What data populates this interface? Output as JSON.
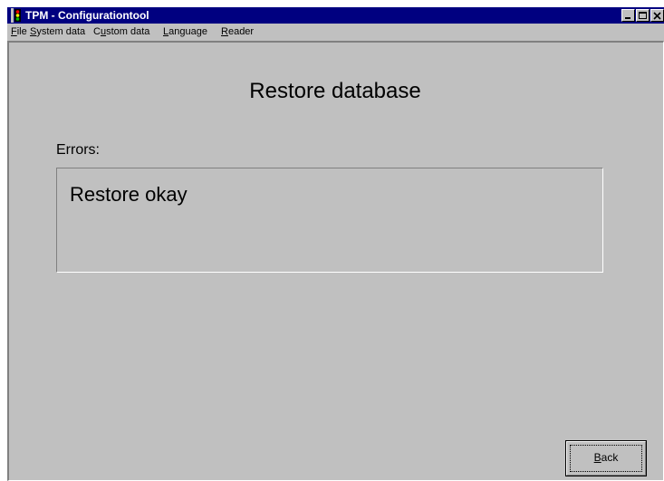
{
  "window": {
    "title": "TPM - Configurationtool",
    "icon": "traffic-light-icon",
    "controls": [
      "minimize-icon",
      "maximize-icon",
      "close-icon"
    ]
  },
  "menu": {
    "items": [
      {
        "label": "File",
        "mnemonic": "F"
      },
      {
        "label": "System data",
        "mnemonic": "S"
      },
      {
        "label": "Custom data",
        "mnemonic": "u"
      },
      {
        "label": "Language",
        "mnemonic": "L"
      },
      {
        "label": "Reader",
        "mnemonic": "R"
      }
    ]
  },
  "main": {
    "heading": "Restore database",
    "errors_label": "Errors:",
    "result_text": "Restore okay",
    "back_label": "Back"
  },
  "colors": {
    "titlebar": "#000080",
    "face": "#c0c0c0"
  }
}
